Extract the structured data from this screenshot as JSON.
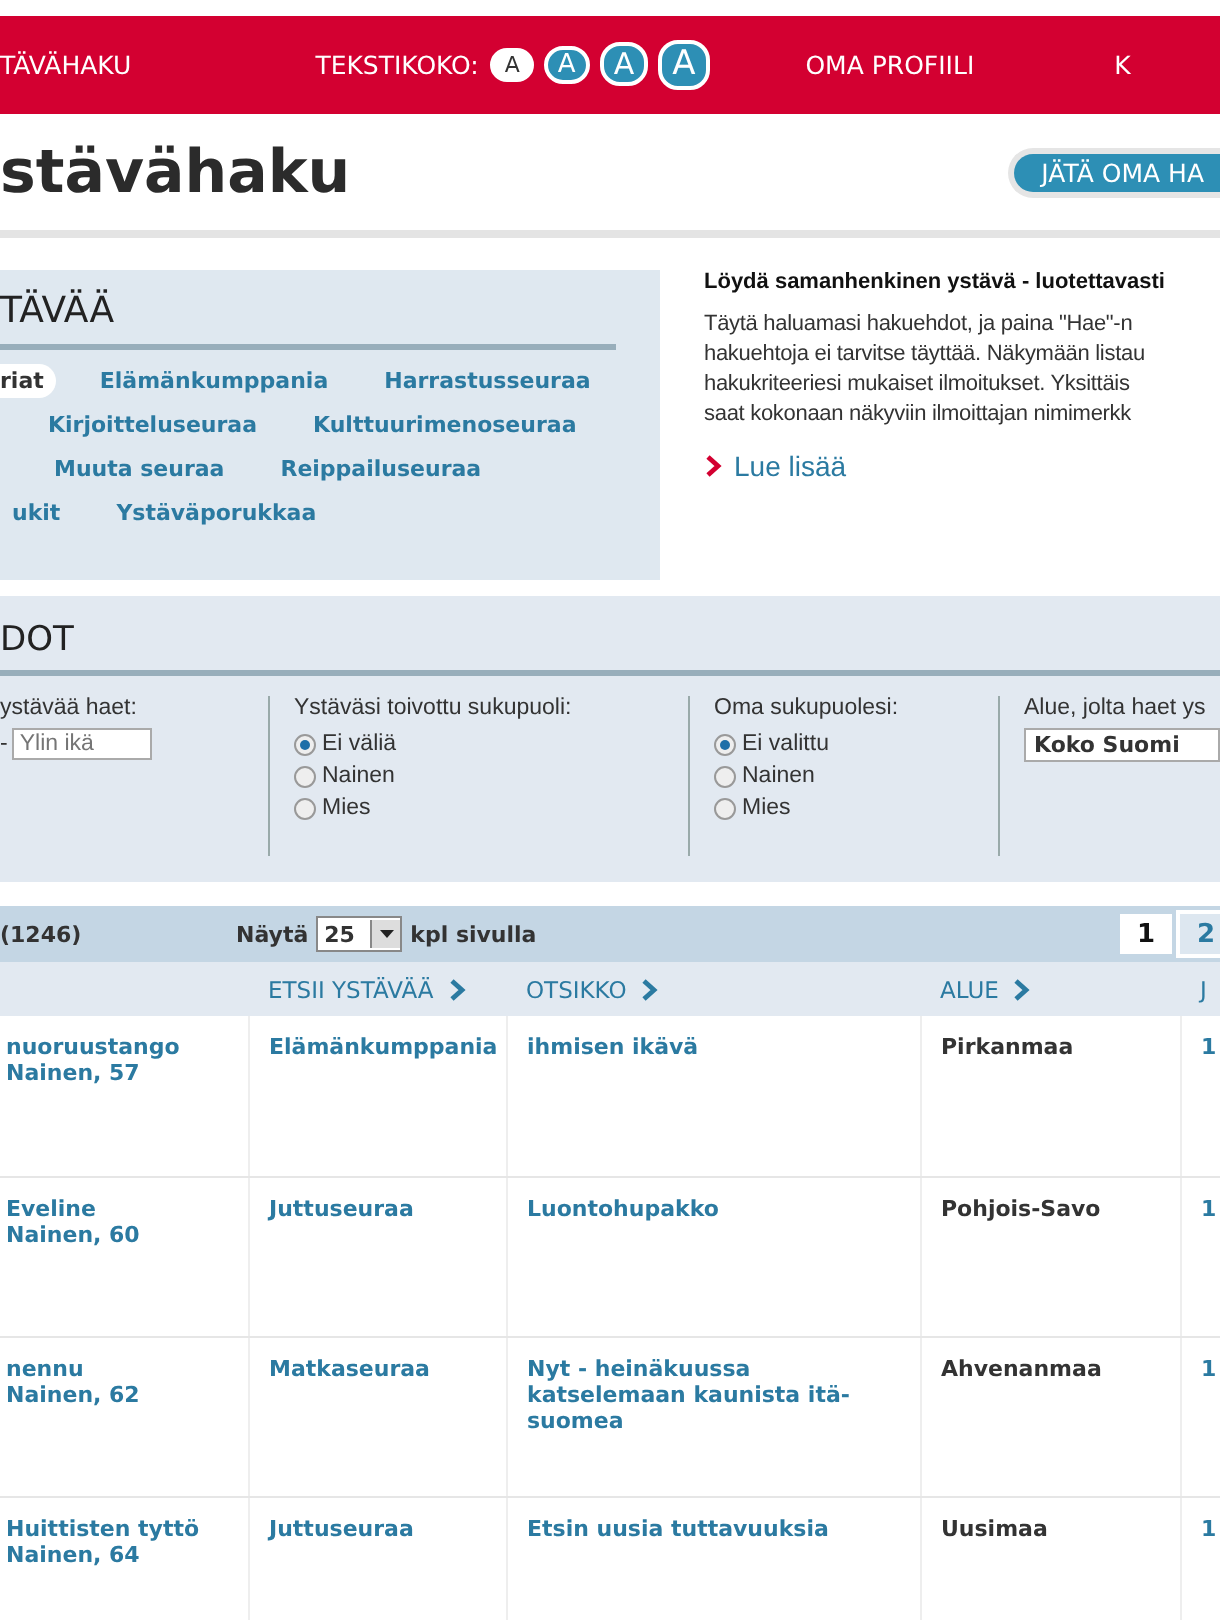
{
  "nav": {
    "items": [
      {
        "label": "TÄVÄHAKU"
      },
      {
        "label": "OMA PROFIILI"
      },
      {
        "label": "K"
      }
    ],
    "text_size_label": "TEKSTIKOKO:",
    "text_size_buttons": [
      {
        "label": "A",
        "selected": true
      },
      {
        "label": "A",
        "selected": false
      },
      {
        "label": "A",
        "selected": false
      },
      {
        "label": "A",
        "selected": false
      }
    ]
  },
  "page_title": "stävähaku",
  "cta_button": "JÄTÄ OMA HA",
  "categories": {
    "title": "TÄVÄÄ",
    "rows": [
      [
        {
          "label": "riat",
          "selected": true
        },
        {
          "label": "Elämänkumppania",
          "selected": false
        },
        {
          "label": "Harrastusseuraa",
          "selected": false
        }
      ],
      [
        {
          "label": "Kirjoitteluseuraa",
          "selected": false
        },
        {
          "label": "Kulttuurimenoseuraa",
          "selected": false
        }
      ],
      [
        {
          "label": "Muuta seuraa",
          "selected": false
        },
        {
          "label": "Reippailuseuraa",
          "selected": false
        }
      ],
      [
        {
          "label": "ukit",
          "selected": false
        },
        {
          "label": "Ystäväporukkaa",
          "selected": false
        }
      ]
    ]
  },
  "intro": {
    "heading": "Löydä samanhenkinen ystävä - luotettavasti",
    "lines": [
      "Täytä haluamasi hakuehdot, ja paina \"Hae\"-n",
      "hakuehtoja ei tarvitse täyttää. Näkymään listau",
      "hakukriteeriesi mukaiset ilmoitukset. Yksittäis",
      "saat kokonaan näkyviin ilmoittajan nimimerkk"
    ],
    "link": "Lue lisää"
  },
  "filters": {
    "title": "DOT",
    "groups": [
      {
        "kind": "age",
        "label": "ystävää haet:",
        "separator": "-",
        "placeholder": "Ylin ikä"
      },
      {
        "kind": "radio",
        "label": "Ystäväsi toivottu sukupuoli:",
        "options": [
          {
            "label": "Ei väliä",
            "selected": true
          },
          {
            "label": "Nainen",
            "selected": false
          },
          {
            "label": "Mies",
            "selected": false
          }
        ]
      },
      {
        "kind": "radio",
        "label": "Oma sukupuolesi:",
        "options": [
          {
            "label": "Ei valittu",
            "selected": true
          },
          {
            "label": "Nainen",
            "selected": false
          },
          {
            "label": "Mies",
            "selected": false
          }
        ]
      },
      {
        "kind": "select",
        "label": "Alue, jolta haet ys",
        "value": "Koko Suomi"
      }
    ]
  },
  "results": {
    "count": "(1246)",
    "show_label": "Näytä",
    "per_page": "25",
    "per_page_suffix": "kpl sivulla",
    "pages": [
      {
        "label": "1",
        "selected": true
      },
      {
        "label": "2",
        "selected": false
      }
    ]
  },
  "table": {
    "columns": [
      "",
      "ETSII YSTÄVÄÄ",
      "OTSIKKO",
      "ALUE",
      "J"
    ],
    "rows": [
      {
        "name": "nuoruustango",
        "details": "Nainen, 57",
        "seeking": "Elämänkumppania",
        "title": "ihmisen ikävä",
        "area": "Pirkanmaa",
        "column_5": "1"
      },
      {
        "name": "Eveline",
        "details": "Nainen, 60",
        "seeking": "Juttuseuraa",
        "title": "Luontohupakko",
        "area": "Pohjois-Savo",
        "column_5": "1"
      },
      {
        "name": "nennu",
        "details": "Nainen, 62",
        "seeking": "Matkaseuraa",
        "title": "Nyt - heinäkuussa katselemaan kaunista itä-suomea",
        "area": "Ahvenanmaa",
        "column_5": "1"
      },
      {
        "name": "Huittisten tyttö",
        "details": "Nainen, 64",
        "seeking": "Juttuseuraa",
        "title": "Etsin uusia tuttavuuksia",
        "area": "Uusimaa",
        "column_5": "1"
      }
    ]
  }
}
